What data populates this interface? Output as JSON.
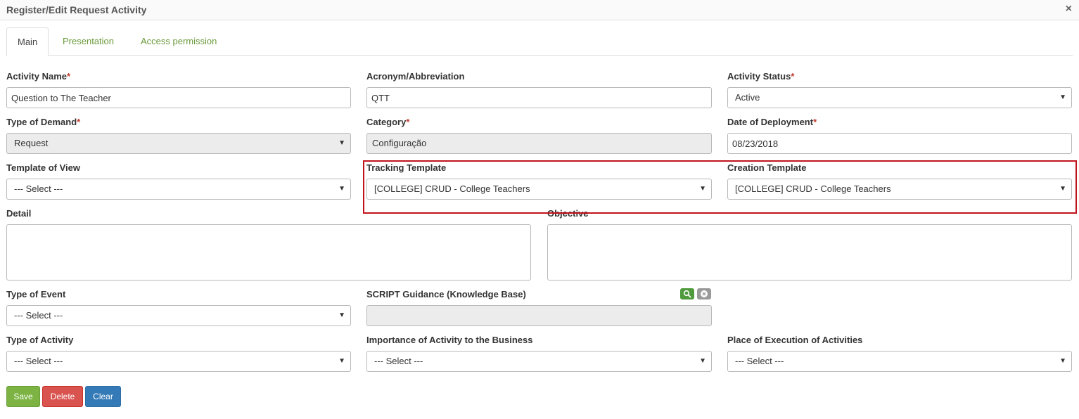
{
  "dialog": {
    "title": "Register/Edit Request Activity",
    "close_glyph": "×"
  },
  "tabs": [
    {
      "label": "Main",
      "active": true
    },
    {
      "label": "Presentation",
      "active": false
    },
    {
      "label": "Access permission",
      "active": false
    }
  ],
  "required_mark": "*",
  "fields": {
    "activity_name": {
      "label": "Activity Name",
      "value": "Question to The Teacher",
      "required": true
    },
    "acronym": {
      "label": "Acronym/Abbreviation",
      "value": "QTT"
    },
    "activity_status": {
      "label": "Activity Status",
      "value": "Active",
      "required": true
    },
    "type_of_demand": {
      "label": "Type of Demand",
      "value": "Request",
      "required": true
    },
    "category": {
      "label": "Category",
      "value": "Configuração",
      "required": true
    },
    "date_of_deployment": {
      "label": "Date of Deployment",
      "value": "08/23/2018",
      "required": true
    },
    "template_of_view": {
      "label": "Template of View",
      "value": "--- Select ---"
    },
    "tracking_template": {
      "label": "Tracking Template",
      "value": "[COLLEGE] CRUD - College Teachers"
    },
    "creation_template": {
      "label": "Creation Template",
      "value": "[COLLEGE] CRUD - College Teachers"
    },
    "detail": {
      "label": "Detail",
      "value": ""
    },
    "objective": {
      "label": "Objective",
      "value": ""
    },
    "type_of_event": {
      "label": "Type of Event",
      "value": "--- Select ---"
    },
    "script_guidance": {
      "label": "SCRIPT Guidance (Knowledge Base)",
      "value": ""
    },
    "type_of_activity": {
      "label": "Type of Activity",
      "value": "--- Select ---"
    },
    "importance": {
      "label": "Importance of Activity to the Business",
      "value": "--- Select ---"
    },
    "place_of_execution": {
      "label": "Place of Execution of Activities",
      "value": "--- Select ---"
    }
  },
  "icons": {
    "caret": "▼",
    "search": "search-icon",
    "clear": "clear-icon"
  },
  "actions": {
    "save": "Save",
    "delete": "Delete",
    "clear": "Clear"
  },
  "colors": {
    "highlight": "#c0141c",
    "tab_link": "#6a9a3a",
    "save": "#7cb342",
    "delete": "#d9534f",
    "clear": "#337ab7",
    "required": "#c0392b"
  }
}
